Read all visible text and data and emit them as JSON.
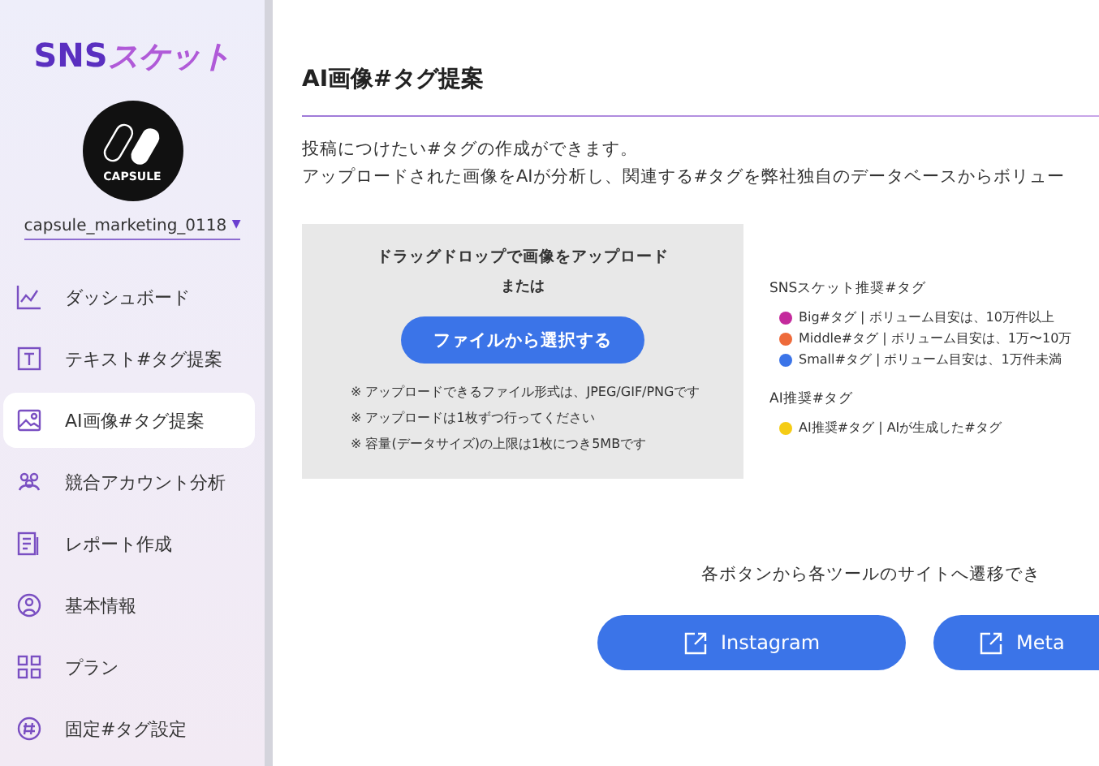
{
  "sidebar": {
    "logo": {
      "latin": "SNS",
      "kana": "スケット"
    },
    "avatar_text": "CAPSULE",
    "account": {
      "name": "capsule_marketing_0118",
      "caret": "▼"
    },
    "items": [
      {
        "label": "ダッシュボード",
        "selected": false
      },
      {
        "label": "テキスト#タグ提案",
        "selected": false
      },
      {
        "label": "AI画像#タグ提案",
        "selected": true
      },
      {
        "label": "競合アカウント分析",
        "selected": false
      },
      {
        "label": "レポート作成",
        "selected": false
      },
      {
        "label": "基本情報",
        "selected": false
      },
      {
        "label": "プラン",
        "selected": false
      },
      {
        "label": "固定#タグ設定",
        "selected": false
      }
    ]
  },
  "main": {
    "title": "AI画像#タグ提案",
    "description": [
      "投稿につけたい#タグの作成ができます。",
      "アップロードされた画像をAIが分析し、関連する#タグを弊社独自のデータベースからボリュー"
    ],
    "upload": {
      "heading": "ドラッグドロップで画像をアップロード",
      "or": "または",
      "button": "ファイルから選択する",
      "notes": [
        "※ アップロードできるファイル形式は、JPEG/GIF/PNGです",
        "※ アップロードは1枚ずつ行ってください",
        "※ 容量(データサイズ)の上限は1枚につき5MBです"
      ]
    },
    "legend": [
      {
        "title": "SNSスケット推奨#タグ",
        "items": [
          {
            "label": "Big#タグ | ボリューム目安は、10万件以上",
            "color": "#c42a9c"
          },
          {
            "label": "Middle#タグ | ボリューム目安は、1万〜10万",
            "color": "#ee6a3a"
          },
          {
            "label": "Small#タグ | ボリューム目安は、1万件未満",
            "color": "#3b74e8"
          }
        ]
      },
      {
        "title": "AI推奨#タグ",
        "items": [
          {
            "label": "AI推奨#タグ | AIが生成した#タグ",
            "color": "#f5cc15"
          }
        ]
      }
    ],
    "links_note": "各ボタンから各ツールのサイトへ遷移でき",
    "links": [
      "Instagram",
      "Meta"
    ]
  }
}
